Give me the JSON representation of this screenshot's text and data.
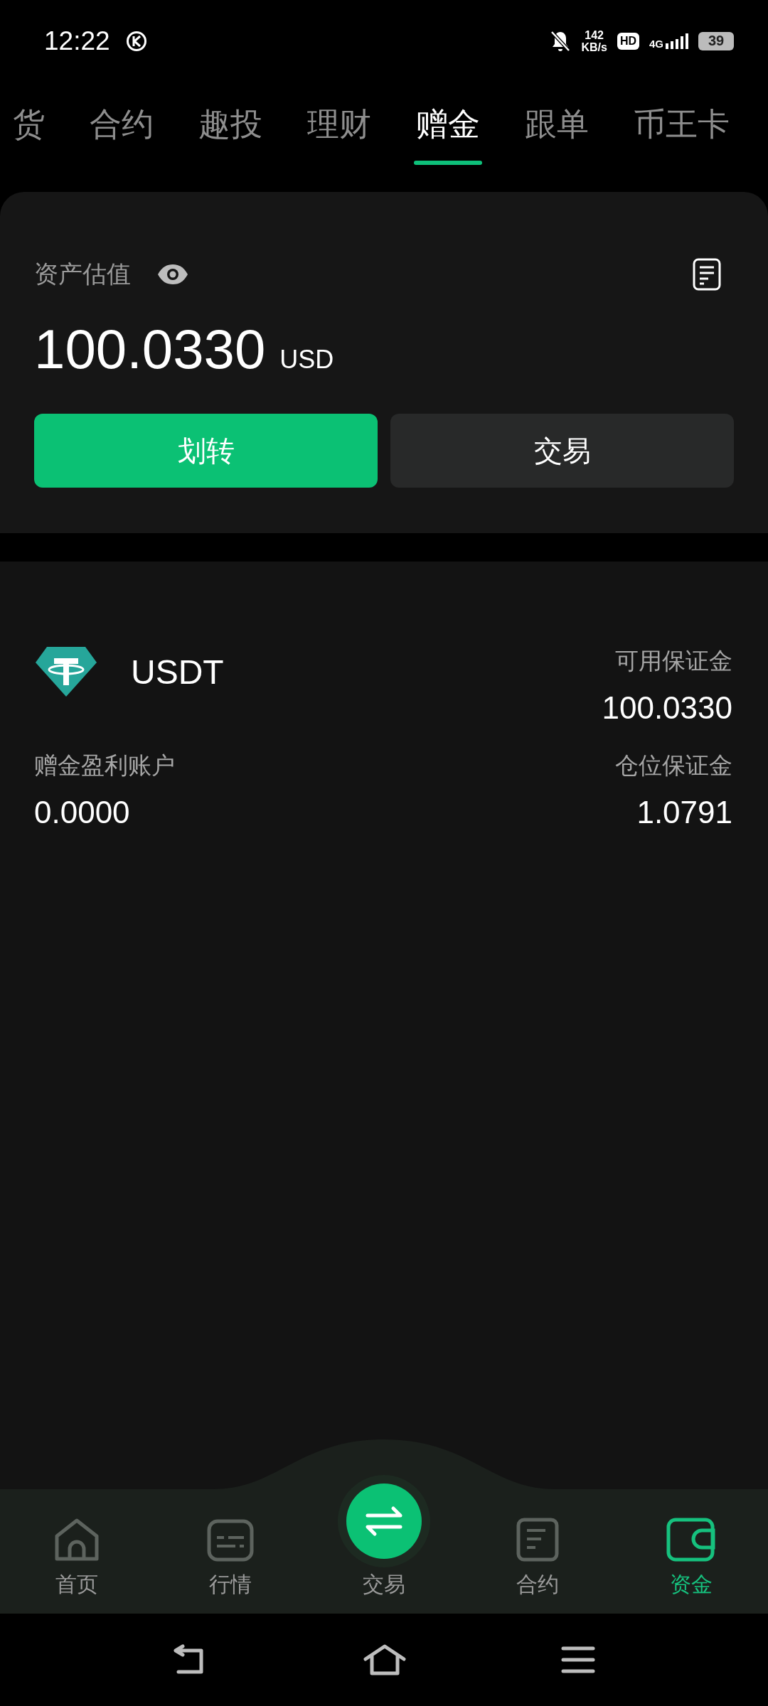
{
  "status_bar": {
    "time": "12:22",
    "speed_value": "142",
    "speed_unit": "KB/s",
    "hd": "HD",
    "network": "4G",
    "battery": "39"
  },
  "tabs": [
    {
      "label": "货",
      "selected": false
    },
    {
      "label": "合约",
      "selected": false
    },
    {
      "label": "趣投",
      "selected": false
    },
    {
      "label": "理财",
      "selected": false
    },
    {
      "label": "赠金",
      "selected": true
    },
    {
      "label": "跟单",
      "selected": false
    },
    {
      "label": "币王卡",
      "selected": false
    }
  ],
  "asset": {
    "label": "资产估值",
    "amount": "100.0330",
    "currency": "USD",
    "buttons": [
      {
        "label": "划转",
        "kind": "primary"
      },
      {
        "label": "交易",
        "kind": "secondary"
      }
    ]
  },
  "account": {
    "coin": "USDT",
    "fields": [
      {
        "label": "可用保证金",
        "value": "100.0330"
      },
      {
        "label": "赠金盈利账户",
        "value": "0.0000"
      },
      {
        "label": "仓位保证金",
        "value": "1.0791"
      }
    ]
  },
  "bottom_nav": [
    {
      "label": "首页",
      "kind": "home",
      "selected": false
    },
    {
      "label": "行情",
      "kind": "market",
      "selected": false
    },
    {
      "label": "交易",
      "kind": "trade",
      "selected": false
    },
    {
      "label": "合约",
      "kind": "contract",
      "selected": false
    },
    {
      "label": "资金",
      "kind": "wallet",
      "selected": true
    }
  ]
}
